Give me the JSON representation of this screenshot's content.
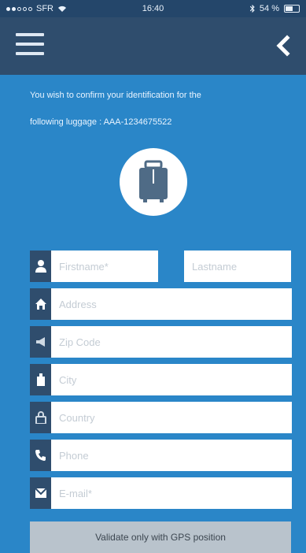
{
  "status_bar": {
    "carrier": "SFR",
    "time": "16:40",
    "battery_text": "54 %"
  },
  "navbar": {
    "menu_icon": "hamburger-icon",
    "back_icon": "chevron-left-icon"
  },
  "intro": {
    "line1": "You wish to confirm your identification for the",
    "line2": "following luggage : AAA-1234675522"
  },
  "avatar": {
    "icon": "luggage-icon"
  },
  "form": {
    "firstname_placeholder": "Firstname*",
    "lastname_placeholder": "Lastname",
    "address_placeholder": "Address",
    "zip_placeholder": "Zip Code",
    "city_placeholder": "City",
    "country_placeholder": "Country",
    "phone_placeholder": "Phone",
    "email_placeholder": "E-mail*"
  },
  "validate_button": "Validate only with GPS position",
  "colors": {
    "background": "#2a86c8",
    "navbar": "#2f4d6d",
    "icon_box": "#2f4d6d",
    "button": "#b9c3cc"
  }
}
